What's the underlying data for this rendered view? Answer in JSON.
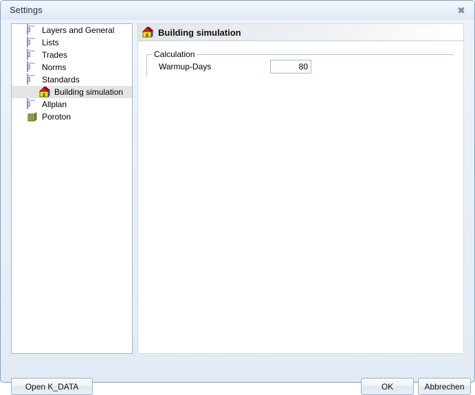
{
  "window": {
    "title": "Settings",
    "close_label": "✖"
  },
  "tree": {
    "items": [
      {
        "label": "Layers and General",
        "icon": "page-icon",
        "level": 0,
        "selected": false
      },
      {
        "label": "Lists",
        "icon": "page-icon",
        "level": 0,
        "selected": false
      },
      {
        "label": "Trades",
        "icon": "page-icon",
        "level": 0,
        "selected": false
      },
      {
        "label": "Norms",
        "icon": "page-icon",
        "level": 0,
        "selected": false
      },
      {
        "label": "Standards",
        "icon": "page-icon",
        "level": 0,
        "selected": false
      },
      {
        "label": "Building simulation",
        "icon": "house-icon",
        "level": 1,
        "selected": true
      },
      {
        "label": "Allplan",
        "icon": "page-icon",
        "level": 0,
        "selected": false
      },
      {
        "label": "Poroton",
        "icon": "brick-icon",
        "level": 0,
        "selected": false
      }
    ]
  },
  "content": {
    "header_title": "Building simulation",
    "header_icon": "house-icon",
    "group": {
      "legend": "Calculation",
      "field_label": "Warmup-Days",
      "field_value": "80"
    }
  },
  "footer": {
    "open_label": "Open K_DATA",
    "ok_label": "OK",
    "cancel_label": "Abbrechen"
  },
  "colors": {
    "window_border": "#7ea2c4",
    "titlebar_top": "#f3f7fb",
    "titlebar_bottom": "#dfe9f4",
    "tree_border": "#9fb6ce",
    "selection": "#e4e4e4",
    "groupbox_border": "#aec3d8",
    "input_border": "#a7b8cb",
    "button_border": "#98aec6"
  }
}
